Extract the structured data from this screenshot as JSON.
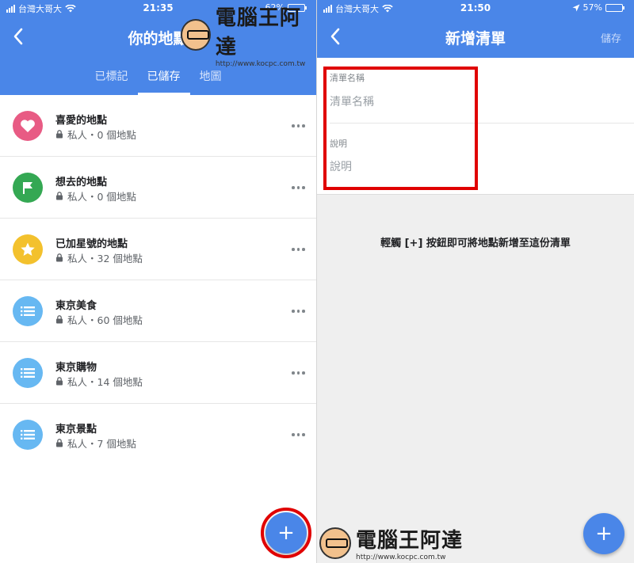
{
  "left": {
    "status": {
      "carrier": "台灣大哥大",
      "time": "21:35",
      "battery": "62%",
      "battery_level": 0.62
    },
    "header": {
      "title": "你的地點"
    },
    "tabs": [
      {
        "label": "已標記",
        "active": false
      },
      {
        "label": "已儲存",
        "active": true
      },
      {
        "label": "地圖",
        "active": false
      }
    ],
    "lists": [
      {
        "name": "喜愛的地點",
        "meta": "私人・0 個地點",
        "icon": "heart-icon",
        "color": "#e85b84"
      },
      {
        "name": "想去的地點",
        "meta": "私人・0 個地點",
        "icon": "flag-icon",
        "color": "#34a853"
      },
      {
        "name": "已加星號的地點",
        "meta": "私人・32 個地點",
        "icon": "star-icon",
        "color": "#f3c12d"
      },
      {
        "name": "東京美食",
        "meta": "私人・60 個地點",
        "icon": "list-icon",
        "color": "#67b8f2"
      },
      {
        "name": "東京購物",
        "meta": "私人・14 個地點",
        "icon": "list-icon",
        "color": "#67b8f2"
      },
      {
        "name": "東京景點",
        "meta": "私人・7 個地點",
        "icon": "list-icon",
        "color": "#67b8f2"
      }
    ],
    "fab_label": "+"
  },
  "right": {
    "status": {
      "carrier": "台灣大哥大",
      "time": "21:50",
      "battery": "57%",
      "battery_level": 0.57
    },
    "header": {
      "title": "新增清單",
      "save_label": "儲存"
    },
    "form": {
      "name_label": "清單名稱",
      "name_placeholder": "清單名稱",
      "name_value": "",
      "desc_label": "說明",
      "desc_placeholder": "說明",
      "desc_value": ""
    },
    "hint": "輕觸 [+] 按鈕即可將地點新增至這份清單",
    "fab_label": "+"
  },
  "watermark": {
    "title": "電腦王阿達",
    "url": "http://www.kocpc.com.tw"
  },
  "colors": {
    "header": "#4a86e8",
    "highlight": "#e00000"
  }
}
